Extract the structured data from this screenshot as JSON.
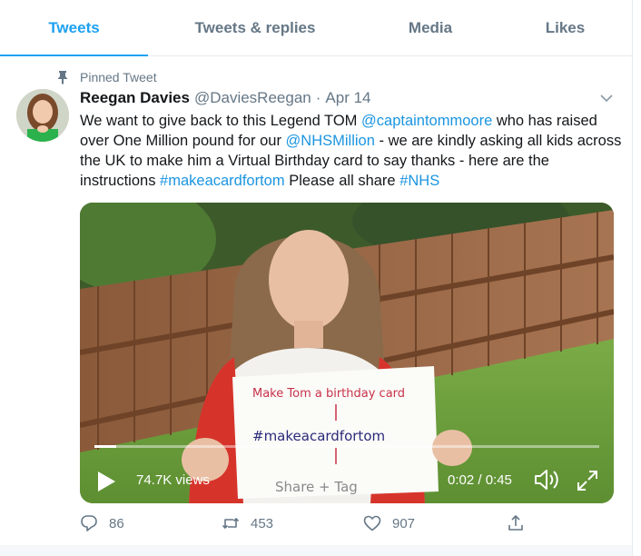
{
  "tabs": [
    {
      "label": "Tweets",
      "active": true
    },
    {
      "label": "Tweets & replies",
      "active": false
    },
    {
      "label": "Media",
      "active": false
    },
    {
      "label": "Likes",
      "active": false
    }
  ],
  "pinned_label": "Pinned Tweet",
  "tweet": {
    "name": "Reegan Davies",
    "handle": "@DaviesReegan",
    "separator": "·",
    "date": "Apr 14",
    "text": {
      "t1": "We want to give back to this Legend TOM ",
      "mention1": "@captaintommoore",
      "t2": " who has raised over One Million pound for our ",
      "mention2": "@NHSMillion",
      "t3": " - we are kindly asking all kids across the UK to make him a Virtual Birthday card to say thanks - here are the instructions ",
      "hashtag1": "#makeacardfortom",
      "t4": " Please all share ",
      "hashtag2": "#NHS"
    }
  },
  "video": {
    "sign_line1": "Make Tom a birthday card",
    "sign_line2": "#makeacardfortom",
    "sign_line3": "Share + Tag",
    "views": "74.7K views",
    "timecode": "0:02 / 0:45",
    "progress": 0.044
  },
  "actions": {
    "replies": "86",
    "retweets": "453",
    "likes": "907"
  },
  "colors": {
    "accent": "#1da1f2",
    "link": "#1b95e0",
    "muted": "#657786"
  },
  "icons": [
    "pin-icon",
    "chevron-down-icon",
    "play-icon",
    "volume-icon",
    "fullscreen-icon",
    "reply-icon",
    "retweet-icon",
    "like-icon",
    "share-icon"
  ]
}
